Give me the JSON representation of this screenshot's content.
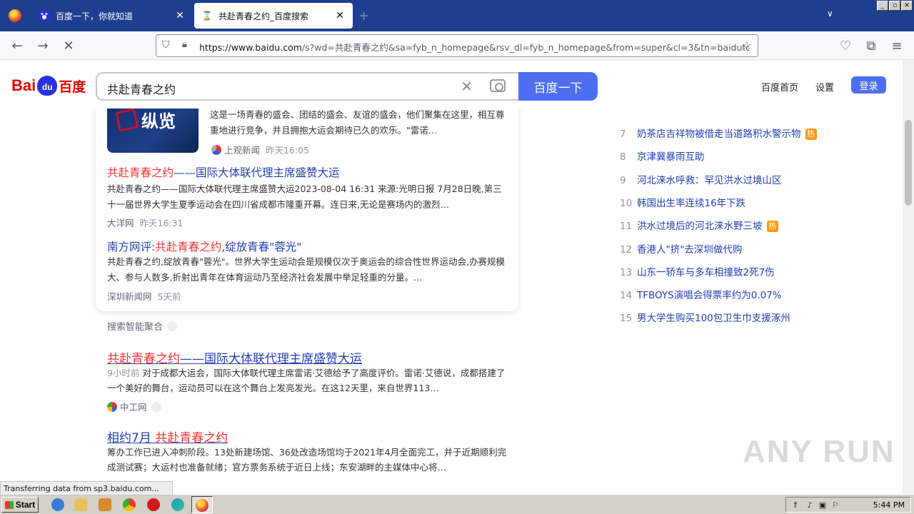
{
  "browser": {
    "tabs": [
      {
        "title": "百度一下，你就知道",
        "favicon": "baidu-paw-icon"
      },
      {
        "title": "共赴青春之约_百度搜索",
        "favicon": "hourglass-icon"
      }
    ],
    "new_tab": "+",
    "url_host": "https://www.baidu.com",
    "url_rest": "/s?wd=共赴青春之约&sa=fyb_n_homepage&rsv_dl=fyb_n_homepage&from=super&cl=3&tn=baidutop10&",
    "status_text": "Transferring data from sp3.baidu.com..."
  },
  "header": {
    "logo_bai": "Bai",
    "logo_du": "du",
    "logo_cn": "百度",
    "query": "共赴青春之约",
    "search_button": "百度一下",
    "home_link": "百度首页",
    "settings_link": "设置",
    "login_button": "登录"
  },
  "card": {
    "thumb_text": "纵览",
    "item0": {
      "snippet": "这是一场青春的盛会、团结的盛会、友谊的盛会，他们聚集在这里，相互尊重地进行竞争，并且拥抱大运会期待已久的欢乐。\"雷诺…",
      "source": "上观新闻",
      "time": "昨天16:05"
    },
    "item1": {
      "title_em": "共赴青春之约",
      "title_rest": "——国际大体联代理主席盛赞大运",
      "snippet": "共赴青春之约——国际大体联代理主席盛赞大运2023-08-04 16:31 来源:光明日报 7月28日晚,第三十一届世界大学生夏季运动会在四川省成都市隆重开幕。连日来,无论是赛场内的激烈…",
      "source": "大洋网",
      "time": "昨天16:31"
    },
    "item2": {
      "title_pre": "南方网评:",
      "title_em": "共赴青春之约",
      "title_rest": ",绽放青春\"蓉光\"",
      "snippet": "共赴青春之约,绽放青春\"蓉光\"。世界大学生运动会是规模仅次于奥运会的综合性世界运动会,办赛规模大、参与人数多,折射出青年在体育运动乃至经济社会发展中举足轻重的分量。…",
      "source": "深圳新闻网",
      "time": "5天前"
    }
  },
  "aggregation_label": "搜索智能聚合",
  "results": [
    {
      "title_em": "共赴青春之约",
      "title_rest": "——国际大体联代理主席盛赞大运",
      "ago": "9小时前",
      "snippet": "对于成都大运会，国际大体联代理主席雷诺·艾德给予了高度评价。雷诺·艾德说，成都搭建了一个美好的舞台，运动员可以在这个舞台上发亮发光。在这12天里，来自世界113…",
      "source": "中工网"
    },
    {
      "title_pre": "相约7月 ",
      "title_em": "共赴青春之约",
      "snippet": "筹办工作已进入冲刺阶段。13处新建场馆、36处改造场馆均于2021年4月全面完工，并于近期顺利完成测试赛；大运村也准备就绪；官方票务系统于近日上线；东安湖畔的主媒体中心将…"
    }
  ],
  "hot_list": [
    {
      "idx": "7",
      "text": "奶茶店吉祥物被借走当道路积水警示物",
      "hot": true
    },
    {
      "idx": "8",
      "text": "京津冀暴雨互助",
      "hot": false
    },
    {
      "idx": "9",
      "text": "河北涞水呼救：罕见洪水过境山区",
      "hot": false
    },
    {
      "idx": "10",
      "text": "韩国出生率连续16年下跌",
      "hot": false
    },
    {
      "idx": "11",
      "text": "洪水过境后的河北涞水野三坡",
      "hot": true
    },
    {
      "idx": "12",
      "text": "香港人\"挤\"去深圳做代购",
      "hot": false
    },
    {
      "idx": "13",
      "text": "山东一轿车与多车相撞致2死7伤",
      "hot": false
    },
    {
      "idx": "14",
      "text": "TFBOYS演唱会得票率约为0.07%",
      "hot": false
    },
    {
      "idx": "15",
      "text": "男大学生购买100包卫生巾支援涿州",
      "hot": false
    }
  ],
  "hot_badge": "热",
  "watermark": "ANY RUN",
  "taskbar": {
    "start_label": "Start",
    "clock": "5:44 PM"
  },
  "colors": {
    "link": "#2440b3",
    "highlight": "#f73131",
    "baidu_blue": "#4e6ef2",
    "tab_bar": "#1e3f8f"
  }
}
